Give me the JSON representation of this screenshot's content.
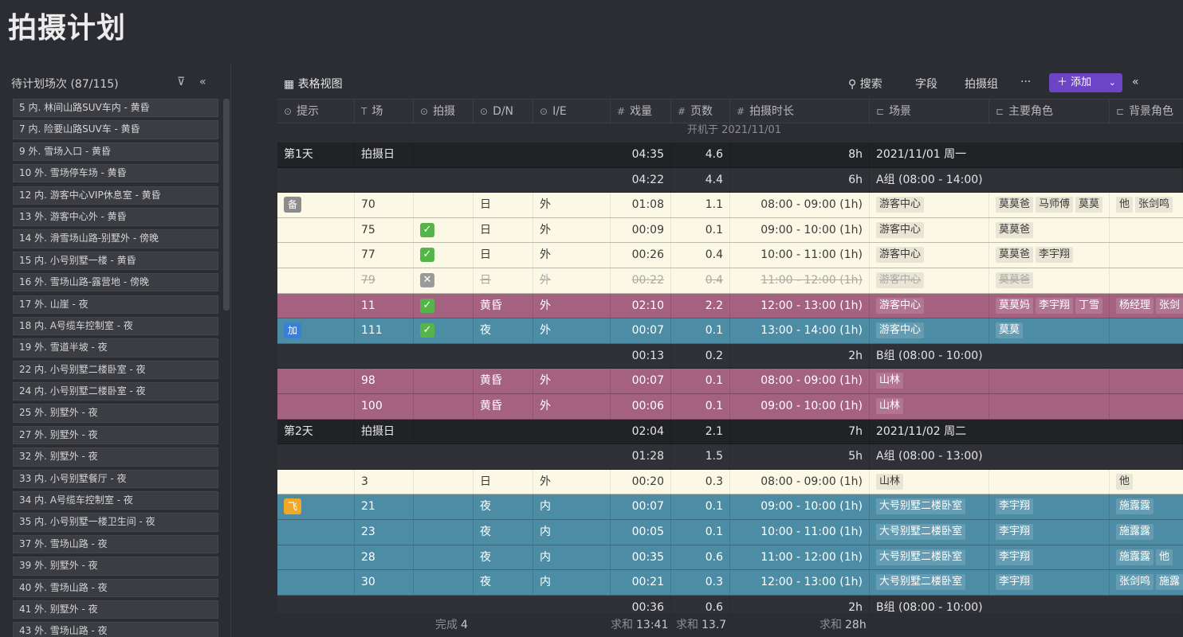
{
  "page_title": "拍摄计划",
  "left_panel": {
    "title": "待计划场次 (87/115)",
    "filter_icon": "filter-icon",
    "collapse_icon": "double-chevron-left-icon",
    "items": [
      "5 内. 林间山路SUV车内 - 黄昏",
      "7 内. 险要山路SUV车 - 黄昏",
      "9 外. 雪场入口 - 黄昏",
      "10 外. 雪场停车场 - 黄昏",
      "12 内. 游客中心VIP休息室 - 黄昏",
      "13 外. 游客中心外 - 黄昏",
      "14 外. 滑雪场山路-别墅外 - 傍晚",
      "15 内. 小号别墅一楼 - 黄昏",
      "16 外. 雪场山路-露营地 - 傍晚",
      "17 外. 山崖 - 夜",
      "18 内. A号缆车控制室 - 夜",
      "19 外. 雪道半坡 - 夜",
      "22 内. 小号别墅二楼卧室 - 夜",
      "24 内. 小号别墅二楼卧室 - 夜",
      "25 外. 别墅外 - 夜",
      "27 外. 别墅外 - 夜",
      "32 外. 别墅外 - 夜",
      "33 内. 小号别墅餐厅 - 夜",
      "34 内. A号缆车控制室 - 夜",
      "35 内. 小号别墅一楼卫生间 - 夜",
      "37 外. 雪场山路 - 夜",
      "39 外. 别墅外 - 夜",
      "40 外. 雪场山路 - 夜",
      "41 外. 别墅外 - 夜",
      "43 外. 雪场山路 - 夜"
    ]
  },
  "toolbar": {
    "view_label": "表格视图",
    "view_icon": "grid-icon",
    "search": "搜索",
    "search_icon": "search-icon",
    "fields": "字段",
    "crew": "拍摄组",
    "more": "···",
    "add": "添加",
    "add_icon": "plus-icon",
    "collapse_icon": "double-chevron-left-icon"
  },
  "columns": {
    "hint": "提示",
    "scene": "场",
    "shoot": "拍摄",
    "dn": "D/N",
    "ie": "I/E",
    "amount": "戏量",
    "pages": "页数",
    "duration": "拍摄时长",
    "location": "场景",
    "main_roles": "主要角色",
    "bg_roles": "背景角色"
  },
  "start_note": "开机于 2021/11/01",
  "rows": [
    {
      "type": "day",
      "hint": "第1天",
      "scene": "拍摄日",
      "amount": "04:35",
      "pages": "4.6",
      "duration": "8h",
      "location": "2021/11/01 周一"
    },
    {
      "type": "group",
      "amount": "04:22",
      "pages": "4.4",
      "duration": "6h",
      "location": "A组 (08:00 - 14:00)"
    },
    {
      "type": "cream",
      "badge": "备",
      "badge_color": "gray",
      "scene": "70",
      "dn": "日",
      "ie": "外",
      "amount": "01:08",
      "pages": "1.1",
      "duration": "08:00 - 09:00 (1h)",
      "location": "游客中心",
      "main_roles": [
        "莫莫爸",
        "马师傅",
        "莫莫"
      ],
      "bg_roles": [
        "他",
        "张剑鸣"
      ]
    },
    {
      "type": "cream",
      "check": "on",
      "scene": "75",
      "dn": "日",
      "ie": "外",
      "amount": "00:09",
      "pages": "0.1",
      "duration": "09:00 - 10:00 (1h)",
      "location": "游客中心",
      "main_roles": [
        "莫莫爸"
      ],
      "bg_roles": []
    },
    {
      "type": "cream",
      "check": "on",
      "scene": "77",
      "dn": "日",
      "ie": "外",
      "amount": "00:26",
      "pages": "0.4",
      "duration": "10:00 - 11:00 (1h)",
      "location": "游客中心",
      "main_roles": [
        "莫莫爸",
        "李宇翔"
      ],
      "bg_roles": []
    },
    {
      "type": "cream strike",
      "check": "off",
      "scene": "79",
      "dn": "日",
      "ie": "外",
      "amount": "00:22",
      "pages": "0.4",
      "duration": "11:00 - 12:00 (1h)",
      "location": "游客中心",
      "main_roles": [
        "莫莫爸"
      ],
      "bg_roles": []
    },
    {
      "type": "purple",
      "check": "on",
      "scene": "11",
      "dn": "黄昏",
      "ie": "外",
      "amount": "02:10",
      "pages": "2.2",
      "duration": "12:00 - 13:00 (1h)",
      "location": "游客中心",
      "main_roles": [
        "莫莫妈",
        "李宇翔",
        "丁雪"
      ],
      "bg_roles": [
        "杨经理",
        "张剑"
      ]
    },
    {
      "type": "teal",
      "badge": "加",
      "badge_color": "blue",
      "check": "on",
      "scene": "111",
      "dn": "夜",
      "ie": "外",
      "amount": "00:07",
      "pages": "0.1",
      "duration": "13:00 - 14:00 (1h)",
      "location": "游客中心",
      "main_roles": [
        "莫莫"
      ],
      "bg_roles": []
    },
    {
      "type": "group",
      "amount": "00:13",
      "pages": "0.2",
      "duration": "2h",
      "location": "B组 (08:00 - 10:00)"
    },
    {
      "type": "purple",
      "scene": "98",
      "dn": "黄昏",
      "ie": "外",
      "amount": "00:07",
      "pages": "0.1",
      "duration": "08:00 - 09:00 (1h)",
      "location": "山林",
      "main_roles": [],
      "bg_roles": []
    },
    {
      "type": "purple",
      "scene": "100",
      "dn": "黄昏",
      "ie": "外",
      "amount": "00:06",
      "pages": "0.1",
      "duration": "09:00 - 10:00 (1h)",
      "location": "山林",
      "main_roles": [],
      "bg_roles": []
    },
    {
      "type": "day",
      "hint": "第2天",
      "scene": "拍摄日",
      "amount": "02:04",
      "pages": "2.1",
      "duration": "7h",
      "location": "2021/11/02 周二"
    },
    {
      "type": "group",
      "amount": "01:28",
      "pages": "1.5",
      "duration": "5h",
      "location": "A组 (08:00 - 13:00)"
    },
    {
      "type": "cream",
      "scene": "3",
      "dn": "日",
      "ie": "外",
      "amount": "00:20",
      "pages": "0.3",
      "duration": "08:00 - 09:00 (1h)",
      "location": "山林",
      "main_roles": [],
      "bg_roles": [
        "他"
      ]
    },
    {
      "type": "teal",
      "badge": "飞",
      "badge_color": "orange",
      "scene": "21",
      "dn": "夜",
      "ie": "内",
      "amount": "00:07",
      "pages": "0.1",
      "duration": "09:00 - 10:00 (1h)",
      "location": "大号别墅二楼卧室",
      "main_roles": [
        "李宇翔"
      ],
      "bg_roles": [
        "施露露"
      ]
    },
    {
      "type": "teal",
      "scene": "23",
      "dn": "夜",
      "ie": "内",
      "amount": "00:05",
      "pages": "0.1",
      "duration": "10:00 - 11:00 (1h)",
      "location": "大号别墅二楼卧室",
      "main_roles": [
        "李宇翔"
      ],
      "bg_roles": [
        "施露露"
      ]
    },
    {
      "type": "teal",
      "scene": "28",
      "dn": "夜",
      "ie": "内",
      "amount": "00:35",
      "pages": "0.6",
      "duration": "11:00 - 12:00 (1h)",
      "location": "大号别墅二楼卧室",
      "main_roles": [
        "李宇翔"
      ],
      "bg_roles": [
        "施露露",
        "他"
      ]
    },
    {
      "type": "teal",
      "scene": "30",
      "dn": "夜",
      "ie": "内",
      "amount": "00:21",
      "pages": "0.3",
      "duration": "12:00 - 13:00 (1h)",
      "location": "大号别墅二楼卧室",
      "main_roles": [
        "李宇翔"
      ],
      "bg_roles": [
        "张剑鸣",
        "施露"
      ]
    },
    {
      "type": "group",
      "amount": "00:36",
      "pages": "0.6",
      "duration": "2h",
      "location": "B组 (08:00 - 10:00)"
    }
  ],
  "footer": {
    "done_label": "完成",
    "done_value": "4",
    "sum_label": "求和",
    "sum_amount": "13:41",
    "sum_pages": "13.7",
    "sum_duration": "28h"
  }
}
